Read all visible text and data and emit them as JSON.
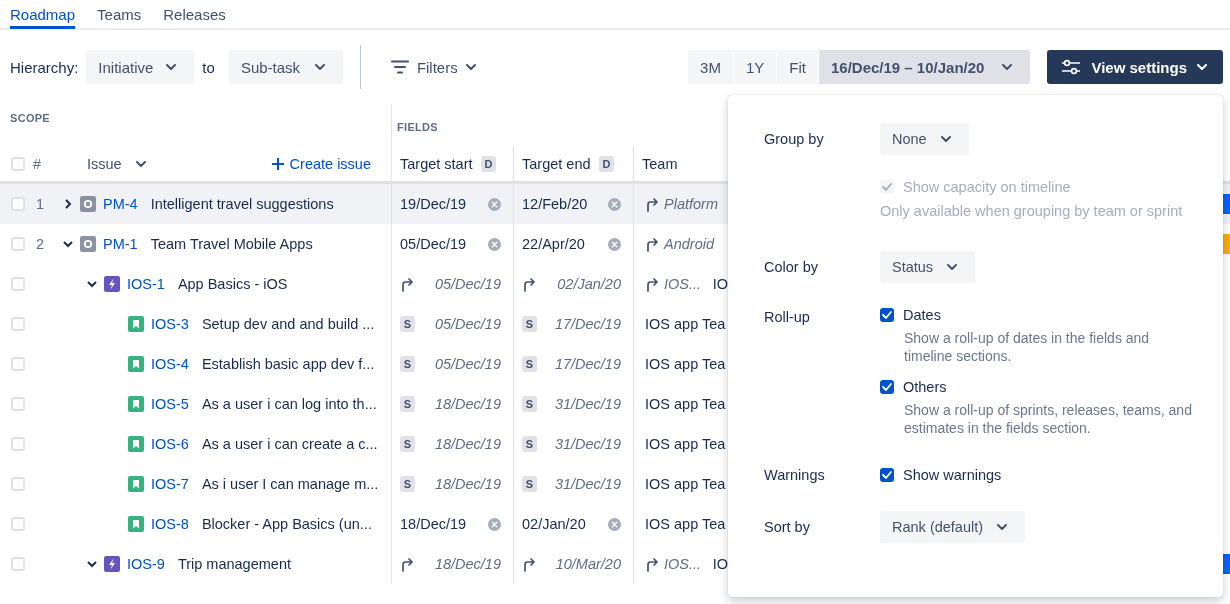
{
  "tabs": [
    {
      "label": "Roadmap",
      "selected": true
    },
    {
      "label": "Teams",
      "selected": false
    },
    {
      "label": "Releases",
      "selected": false
    }
  ],
  "toolbar": {
    "hierarchy_label": "Hierarchy:",
    "hierarchy_from": "Initiative",
    "connector": "to",
    "hierarchy_to": "Sub-task",
    "filters": "Filters",
    "ranges": [
      {
        "label": "3M",
        "selected": false
      },
      {
        "label": "1Y",
        "selected": false
      },
      {
        "label": "Fit",
        "selected": false
      },
      {
        "label": "16/Dec/19 – 10/Jan/20",
        "selected": true
      }
    ],
    "view_settings": "View settings"
  },
  "table": {
    "scope_title": "SCOPE",
    "fields_title": "FIELDS",
    "header_checked": false,
    "number_heading": "#",
    "issue_heading": "Issue",
    "create_issue": "Create issue",
    "columns": [
      {
        "label": "Target start",
        "badge": "D"
      },
      {
        "label": "Target end",
        "badge": "D"
      },
      {
        "label": "Team"
      }
    ],
    "rows": [
      {
        "number": "1",
        "expanded": false,
        "checked": false,
        "selected": true,
        "kind": "initiative",
        "key": "PM-4",
        "summary": "Intelligent travel suggestions",
        "start": {
          "kind": "fixed",
          "text": "19/Dec/19"
        },
        "end": {
          "kind": "fixed",
          "text": "12/Feb/20"
        },
        "team": {
          "kind": "rollup",
          "text": "Platform"
        },
        "color": "#0065ff"
      },
      {
        "number": "2",
        "expanded": true,
        "checked": false,
        "selected": false,
        "kind": "initiative",
        "key": "PM-1",
        "summary": "Team Travel Mobile Apps",
        "start": {
          "kind": "fixed",
          "text": "05/Dec/19"
        },
        "end": {
          "kind": "fixed",
          "text": "22/Apr/20"
        },
        "team": {
          "kind": "rollup",
          "text": "Android"
        },
        "color": "#ffab00",
        "children": [
          {
            "expanded": true,
            "checked": false,
            "selected": false,
            "kind": "epic",
            "key": "IOS-1",
            "summary": "App Basics - iOS",
            "start": {
              "kind": "rollup",
              "text": "05/Dec/19"
            },
            "end": {
              "kind": "rollup",
              "text": "02/Jan/20"
            },
            "team": {
              "kind": "rollup",
              "text": "IOS..."
            },
            "column_5": "IO",
            "children": [
              {
                "checked": false,
                "selected": false,
                "kind": "story",
                "key": "IOS-3",
                "summary": "Setup dev and and build ...",
                "start": {
                  "kind": "sprint",
                  "badge": "S",
                  "text": "05/Dec/19"
                },
                "end": {
                  "kind": "sprint",
                  "badge": "S",
                  "text": "17/Dec/19"
                },
                "team": {
                  "kind": "plain",
                  "text": "IOS app Tea"
                }
              },
              {
                "checked": false,
                "selected": false,
                "kind": "story",
                "key": "IOS-4",
                "summary": "Establish basic app dev f...",
                "start": {
                  "kind": "sprint",
                  "badge": "S",
                  "text": "05/Dec/19"
                },
                "end": {
                  "kind": "sprint",
                  "badge": "S",
                  "text": "17/Dec/19"
                },
                "team": {
                  "kind": "plain",
                  "text": "IOS app Tea"
                }
              },
              {
                "checked": false,
                "selected": false,
                "kind": "story",
                "key": "IOS-5",
                "summary": "As a user i can log into th...",
                "start": {
                  "kind": "sprint",
                  "badge": "S",
                  "text": "18/Dec/19"
                },
                "end": {
                  "kind": "sprint",
                  "badge": "S",
                  "text": "31/Dec/19"
                },
                "team": {
                  "kind": "plain",
                  "text": "IOS app Tea"
                }
              },
              {
                "checked": false,
                "selected": false,
                "kind": "story",
                "key": "IOS-6",
                "summary": "As a user i can create a c...",
                "start": {
                  "kind": "sprint",
                  "badge": "S",
                  "text": "18/Dec/19"
                },
                "end": {
                  "kind": "sprint",
                  "badge": "S",
                  "text": "31/Dec/19"
                },
                "team": {
                  "kind": "plain",
                  "text": "IOS app Tea"
                }
              },
              {
                "checked": false,
                "selected": false,
                "kind": "story",
                "key": "IOS-7",
                "summary": "As i user I can manage m...",
                "start": {
                  "kind": "sprint",
                  "badge": "S",
                  "text": "18/Dec/19"
                },
                "end": {
                  "kind": "sprint",
                  "badge": "S",
                  "text": "31/Dec/19"
                },
                "team": {
                  "kind": "plain",
                  "text": "IOS app Tea"
                }
              },
              {
                "checked": false,
                "selected": false,
                "kind": "story",
                "key": "IOS-8",
                "summary": "Blocker - App Basics (un...",
                "start": {
                  "kind": "fixed",
                  "text": "18/Dec/19"
                },
                "end": {
                  "kind": "fixed",
                  "text": "02/Jan/20"
                },
                "team": {
                  "kind": "plain",
                  "text": "IOS app Tea"
                }
              }
            ]
          },
          {
            "expanded": true,
            "checked": false,
            "selected": false,
            "kind": "epic",
            "key": "IOS-9",
            "summary": "Trip management",
            "start": {
              "kind": "rollup",
              "text": "18/Dec/19"
            },
            "end": {
              "kind": "rollup",
              "text": "10/Mar/20"
            },
            "team": {
              "kind": "rollup",
              "text": "IOS..."
            },
            "column_5": "IO",
            "color": "#0065ff"
          }
        ]
      }
    ]
  },
  "view_settings_panel": {
    "group_by": {
      "label": "Group by",
      "value": "None"
    },
    "capacity": {
      "label": "Show capacity on timeline",
      "checked": true,
      "disabled": true,
      "hint": "Only available when grouping by team or sprint"
    },
    "color_by": {
      "label": "Color by",
      "value": "Status"
    },
    "rollup": {
      "label": "Roll-up",
      "options": [
        {
          "label": "Dates",
          "checked": true,
          "description": "Show a roll-up of dates in the fields and timeline sections."
        },
        {
          "label": "Others",
          "checked": true,
          "description": "Show a roll-up of sprints, releases, teams, and estimates in the fields section."
        }
      ]
    },
    "warnings": {
      "label": "Warnings",
      "option": "Show warnings",
      "checked": true
    },
    "sort_by": {
      "label": "Sort by",
      "value": "Rank (default)"
    }
  }
}
